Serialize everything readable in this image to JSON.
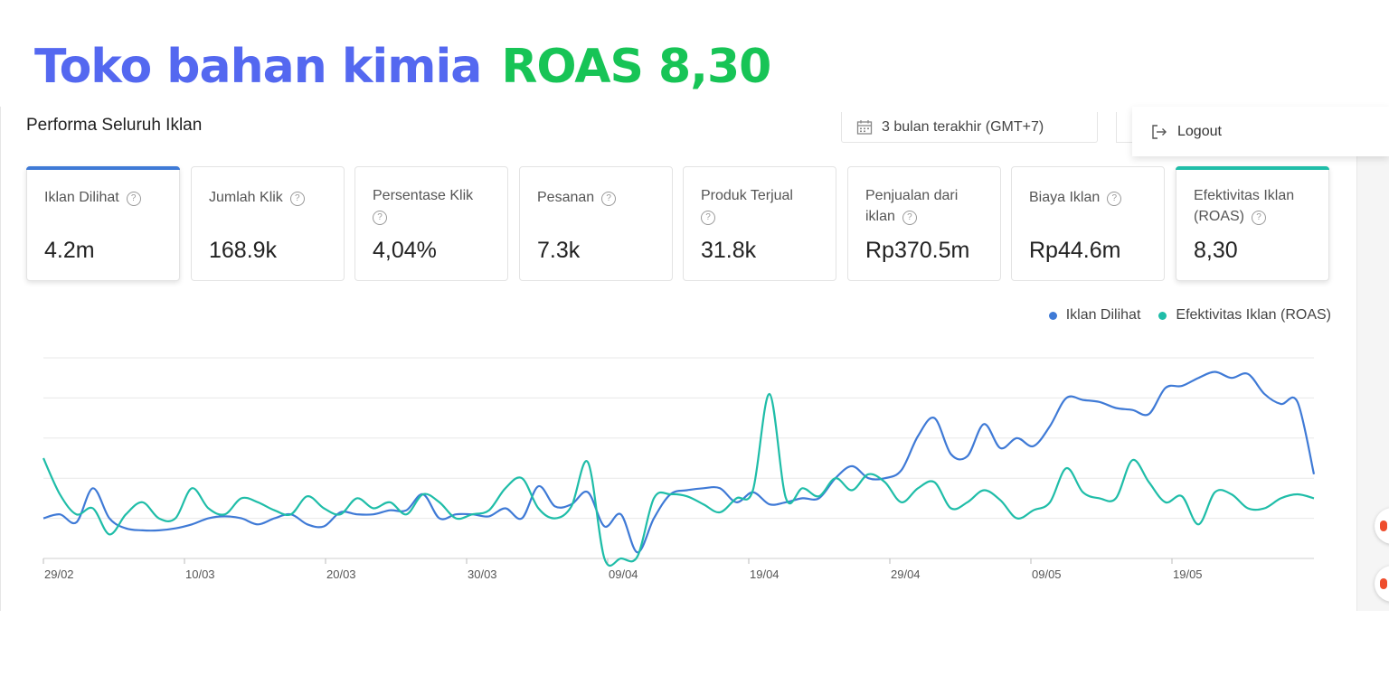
{
  "headline": {
    "store": "Toko bahan kimia",
    "roas": "ROAS 8,30"
  },
  "panel": {
    "title": "Performa Seluruh Iklan"
  },
  "date_picker": {
    "label": "3 bulan terakhir (GMT+7)",
    "icon": "calendar-icon"
  },
  "menu": {
    "logout_label": "Logout",
    "icon": "logout-icon"
  },
  "metrics": [
    {
      "label": "Iklan Dilihat",
      "value": "4.2m"
    },
    {
      "label": "Jumlah Klik",
      "value": "168.9k"
    },
    {
      "label": "Persentase Klik",
      "value": "4,04%"
    },
    {
      "label": "Pesanan",
      "value": "7.3k"
    },
    {
      "label": "Produk Terjual",
      "value": "31.8k"
    },
    {
      "label": "Penjualan dari iklan",
      "value": "Rp370.5m"
    },
    {
      "label": "Biaya Iklan",
      "value": "Rp44.6m"
    },
    {
      "label": "Efektivitas Iklan (ROAS)",
      "value": "8,30"
    }
  ],
  "colors": {
    "blue": "#3f7ad6",
    "teal": "#1fbda8",
    "headline_blue": "#5468f0",
    "headline_green": "#17c456"
  },
  "chart_data": {
    "type": "line",
    "x_ticks": [
      "29/02",
      "10/03",
      "20/03",
      "30/03",
      "09/04",
      "19/04",
      "29/04",
      "09/05",
      "19/05"
    ],
    "grid": true,
    "legend_position": "top-right",
    "series": [
      {
        "name": "Iklan Dilihat",
        "color": "#3f7ad6",
        "values": [
          20,
          22,
          18,
          35,
          20,
          15,
          14,
          14,
          15,
          17,
          20,
          21,
          20,
          17,
          20,
          22,
          17,
          16,
          23,
          22,
          22,
          24,
          24,
          32,
          20,
          22,
          22,
          21,
          25,
          20,
          36,
          26,
          27,
          33,
          16,
          22,
          3,
          20,
          32,
          34,
          35,
          35,
          28,
          33,
          27,
          28,
          30,
          30,
          40,
          46,
          40,
          40,
          44,
          61,
          70,
          52,
          51,
          67,
          55,
          60,
          56,
          66,
          80,
          79,
          78,
          75,
          74,
          72,
          85,
          86,
          90,
          93,
          90,
          92,
          82,
          77,
          78,
          42
        ]
      },
      {
        "name": "Efektivitas Iklan (ROAS)",
        "color": "#1fbda8",
        "values": [
          50,
          32,
          22,
          25,
          12,
          22,
          28,
          20,
          20,
          35,
          25,
          22,
          30,
          28,
          24,
          22,
          31,
          25,
          22,
          30,
          25,
          28,
          22,
          32,
          28,
          20,
          22,
          24,
          35,
          40,
          25,
          20,
          26,
          48,
          0,
          0,
          1,
          30,
          32,
          31,
          27,
          23,
          30,
          34,
          82,
          30,
          35,
          31,
          40,
          34,
          42,
          38,
          28,
          35,
          38,
          25,
          28,
          34,
          29,
          20,
          24,
          28,
          45,
          33,
          30,
          30,
          49,
          38,
          28,
          31,
          17,
          33,
          32,
          25,
          25,
          30,
          32,
          30
        ]
      }
    ]
  }
}
